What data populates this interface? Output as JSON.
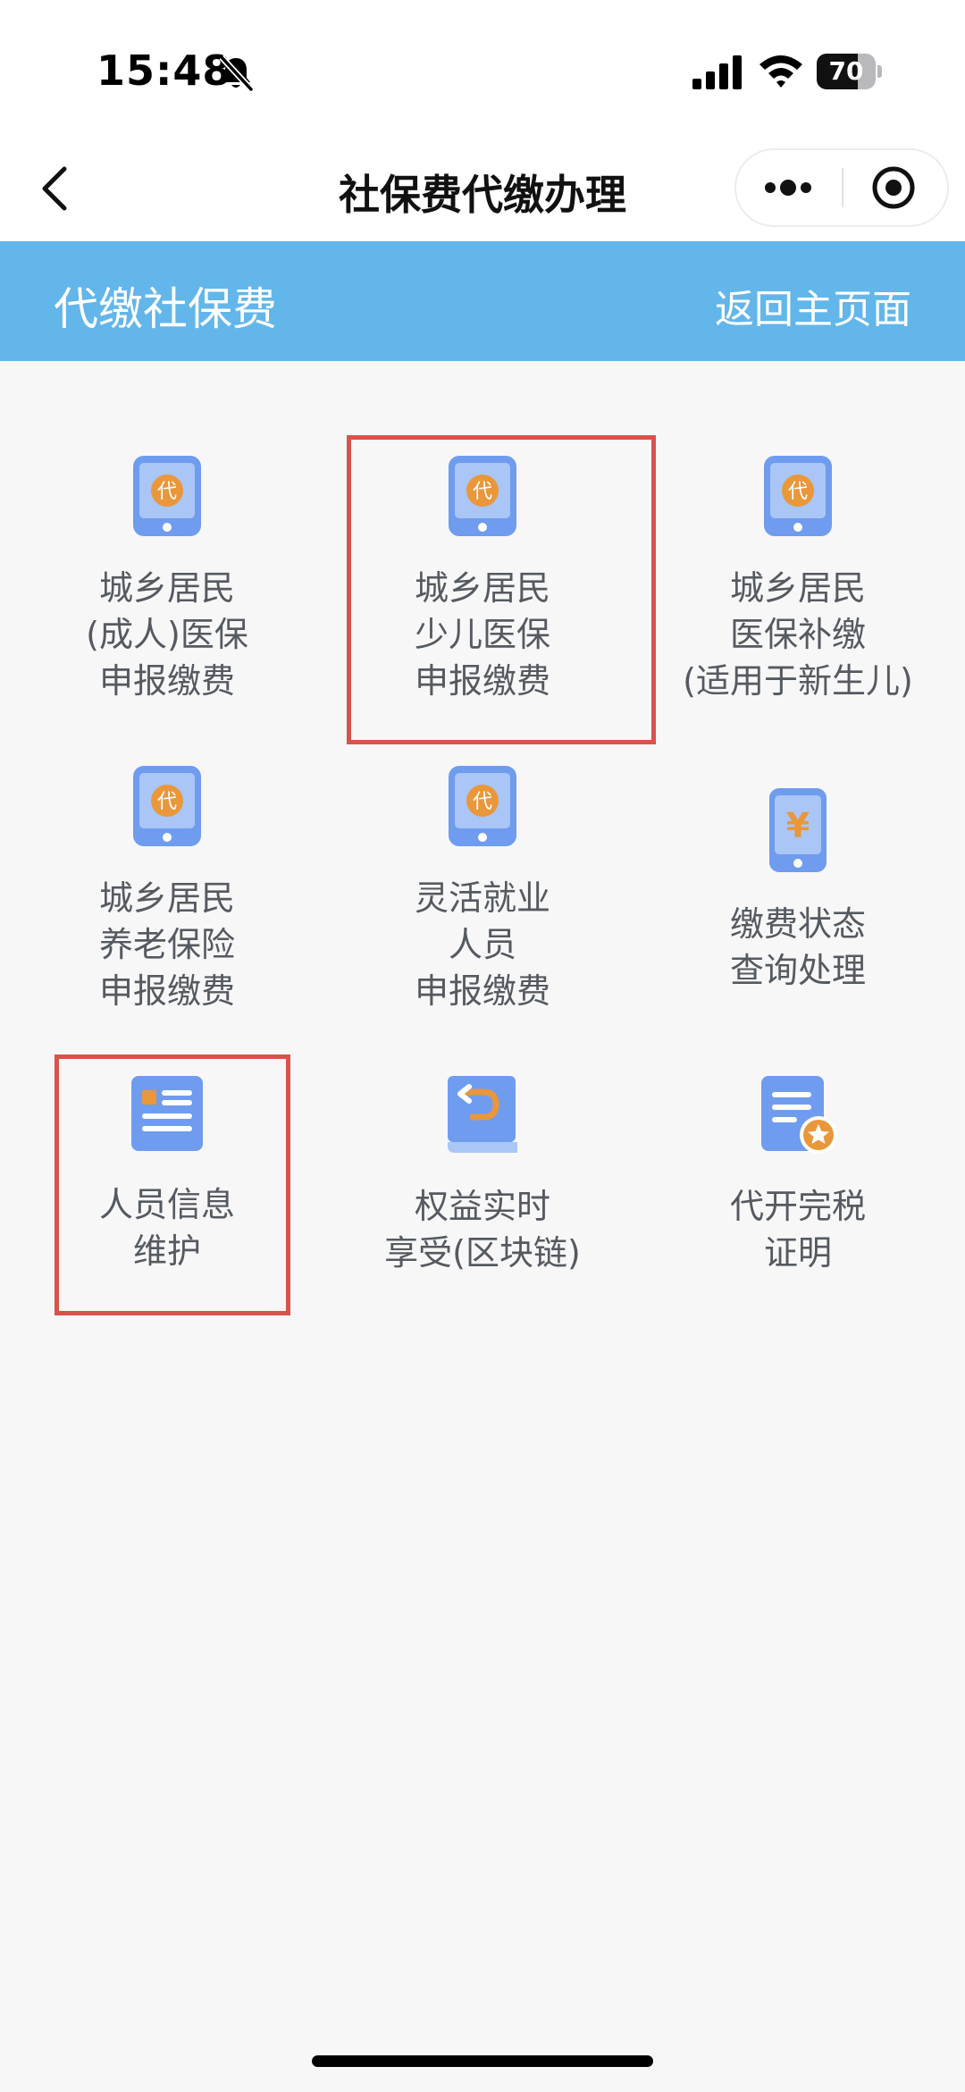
{
  "status_bar": {
    "time": "15:48",
    "battery": "70",
    "battery_level": 0.7,
    "icons": [
      "bell-off-icon",
      "signal-icon",
      "wifi-icon",
      "battery-icon"
    ]
  },
  "nav": {
    "title": "社保费代缴办理",
    "back_icon": "chevron-left-icon",
    "more_icon": "more-dots-icon",
    "close_icon": "target-icon"
  },
  "banner": {
    "title": "代缴社保费",
    "home_link": "返回主页面"
  },
  "colors": {
    "banner": "#62b6ea",
    "phone_icon": "#6f9cef",
    "badge": "#e9973a",
    "highlight": "#d9534a",
    "label": "#555a60"
  },
  "tiles": [
    {
      "icon": "phone-dai-icon",
      "lines": [
        "城乡居民",
        "(成人)医保",
        "申报缴费"
      ]
    },
    {
      "icon": "phone-dai-icon",
      "lines": [
        "城乡居民",
        "少儿医保",
        "申报缴费"
      ]
    },
    {
      "icon": "phone-dai-icon",
      "lines": [
        "城乡居民",
        "医保补缴",
        "(适用于新生儿)"
      ]
    },
    {
      "icon": "phone-dai-icon",
      "lines": [
        "城乡居民",
        "养老保险",
        "申报缴费"
      ]
    },
    {
      "icon": "phone-dai-icon",
      "lines": [
        "灵活就业",
        "人员",
        "申报缴费"
      ]
    },
    {
      "icon": "phone-yen-icon",
      "lines": [
        "缴费状态",
        "查询处理"
      ]
    },
    {
      "icon": "id-card-icon",
      "lines": [
        "人员信息",
        "维护"
      ]
    },
    {
      "icon": "book-icon",
      "lines": [
        "权益实时",
        "享受(区块链)"
      ]
    },
    {
      "icon": "certificate-star-icon",
      "lines": [
        "代开完税",
        "证明"
      ]
    }
  ],
  "icon_glyphs": {
    "dai": "代",
    "yen": "¥"
  }
}
